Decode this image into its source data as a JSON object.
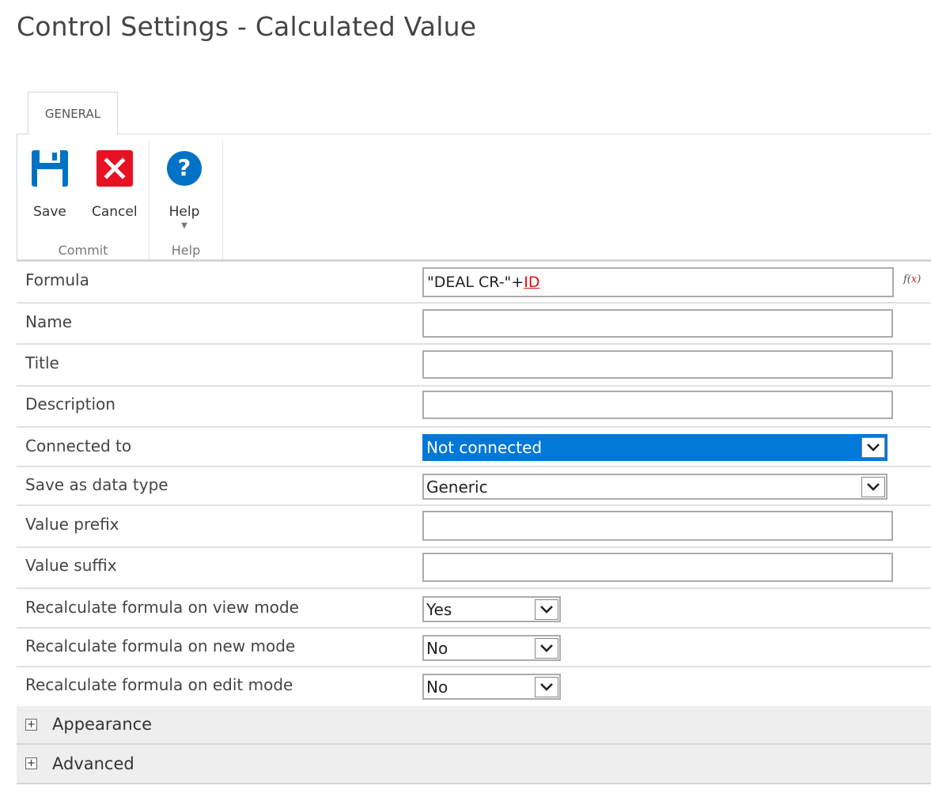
{
  "page": {
    "title": "Control Settings - Calculated Value"
  },
  "tabs": [
    {
      "label": "GENERAL"
    }
  ],
  "ribbon": {
    "groups": [
      {
        "label": "Commit",
        "buttons": [
          {
            "label": "Save",
            "icon": "save-icon",
            "color": "#0072c6"
          },
          {
            "label": "Cancel",
            "icon": "cancel-icon",
            "color": "#e81123"
          }
        ]
      },
      {
        "label": "Help",
        "buttons": [
          {
            "label": "Help",
            "icon": "help-icon",
            "color": "#0072c6",
            "has_dropdown": true
          }
        ]
      }
    ]
  },
  "form": {
    "formula": {
      "label": "Formula",
      "value_prefix": "\"DEAL CR-\"+",
      "value_reference": "ID",
      "fx_button": "f(x)"
    },
    "name": {
      "label": "Name",
      "value": ""
    },
    "title": {
      "label": "Title",
      "value": ""
    },
    "description": {
      "label": "Description",
      "value": ""
    },
    "connected_to": {
      "label": "Connected to",
      "value": "Not connected",
      "highlight_color": "#0078d7"
    },
    "data_type": {
      "label": "Save as data type",
      "value": "Generic"
    },
    "value_prefix": {
      "label": "Value prefix",
      "value": ""
    },
    "value_suffix": {
      "label": "Value suffix",
      "value": ""
    },
    "recalc_view": {
      "label": "Recalculate formula on view mode",
      "value": "Yes"
    },
    "recalc_new": {
      "label": "Recalculate formula on new mode",
      "value": "No"
    },
    "recalc_edit": {
      "label": "Recalculate formula on edit mode",
      "value": "No"
    }
  },
  "sections": [
    {
      "label": "Appearance",
      "expanded": false
    },
    {
      "label": "Advanced",
      "expanded": false
    }
  ]
}
